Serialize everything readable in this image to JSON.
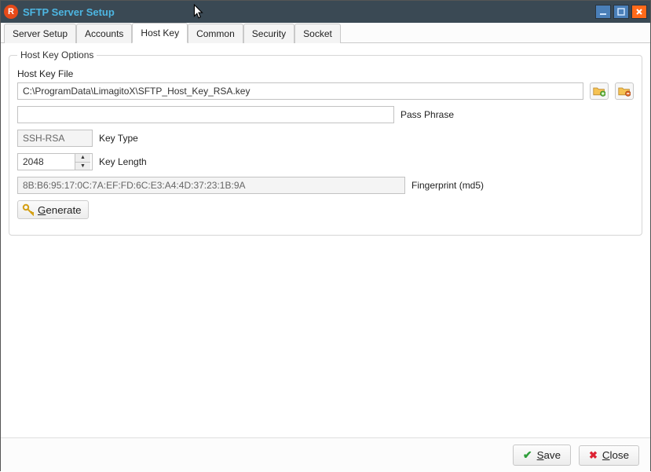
{
  "window": {
    "title": "SFTP Server Setup",
    "app_icon_letter": "R"
  },
  "tabs": [
    {
      "label": "Server Setup",
      "active": false
    },
    {
      "label": "Accounts",
      "active": false
    },
    {
      "label": "Host Key",
      "active": true
    },
    {
      "label": "Common",
      "active": false
    },
    {
      "label": "Security",
      "active": false
    },
    {
      "label": "Socket",
      "active": false
    }
  ],
  "group": {
    "legend": "Host Key Options",
    "file_label": "Host Key File",
    "file_value": "C:\\ProgramData\\LimagitoX\\SFTP_Host_Key_RSA.key",
    "passphrase_label": "Pass Phrase",
    "passphrase_value": "",
    "keytype_label": "Key Type",
    "keytype_value": "SSH-RSA",
    "keylength_label": "Key Length",
    "keylength_value": "2048",
    "fingerprint_label": "Fingerprint (md5)",
    "fingerprint_value": "8B:B6:95:17:0C:7A:EF:FD:6C:E3:A4:4D:37:23:1B:9A",
    "generate_label": "Generate",
    "generate_accel": "G"
  },
  "footer": {
    "save_label": "Save",
    "save_accel": "S",
    "close_label": "Close",
    "close_accel": "C"
  }
}
